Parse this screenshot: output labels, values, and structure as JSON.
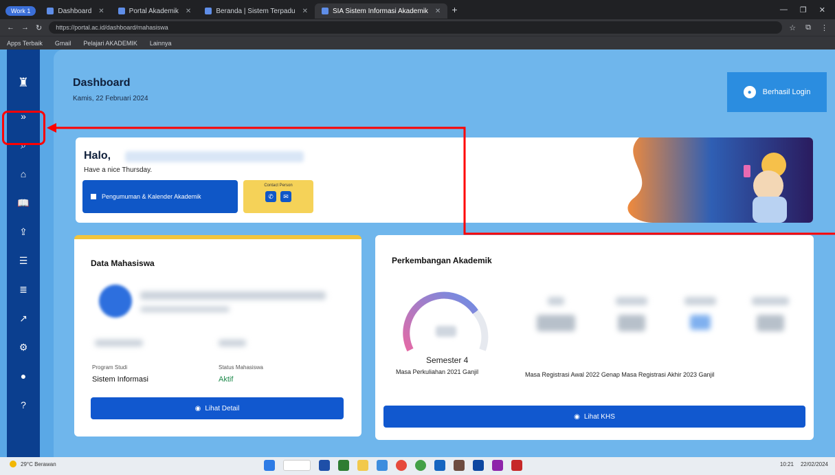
{
  "browser": {
    "profile_label": "Work 1",
    "tabs": [
      {
        "title": "Dashboard",
        "active": false
      },
      {
        "title": "Portal Akademik",
        "active": false
      },
      {
        "title": "Beranda | Sistem Terpadu",
        "active": false
      },
      {
        "title": "SIA Sistem Informasi Akademik",
        "active": true
      }
    ],
    "new_tab": "+",
    "window_controls": [
      "—",
      "❐",
      "✕"
    ],
    "nav": [
      "←",
      "→",
      "↻"
    ],
    "url": "https://portal.ac.id/dashboard/mahasiswa",
    "bookmarks": [
      "Apps Terbaik",
      "Gmail",
      "Pelajari AKADEMIK",
      "Lainnya"
    ]
  },
  "sidebar": {
    "logo_icon": "university-emblem-icon",
    "items": [
      {
        "name": "expand-sidebar",
        "glyph": "»"
      },
      {
        "name": "search",
        "glyph": "⌕"
      },
      {
        "name": "home",
        "glyph": "⌂"
      },
      {
        "name": "book",
        "glyph": "📖"
      },
      {
        "name": "upload",
        "glyph": "⇪"
      },
      {
        "name": "document",
        "glyph": "☰"
      },
      {
        "name": "list",
        "glyph": "≣"
      },
      {
        "name": "chart",
        "glyph": "↗"
      },
      {
        "name": "settings",
        "glyph": "⚙"
      },
      {
        "name": "profile",
        "glyph": "●"
      },
      {
        "name": "help",
        "glyph": "?"
      }
    ]
  },
  "header": {
    "title": "Dashboard",
    "date": "Kamis, 22 Februari 2024",
    "logout_label": "Berhasil Login"
  },
  "greeting": {
    "hello": "Halo,",
    "subtitle": "Have a nice Thursday.",
    "calendar_button": "Pengumuman & Kalender Akademik",
    "contact_label": "Contact Person"
  },
  "student_card": {
    "title": "Data Mahasiswa",
    "program_label": "Program Studi",
    "program_value": "Sistem Informasi",
    "status_label": "Status Mahasiswa",
    "status_value": "Aktif",
    "button_label": "Lihat Detail"
  },
  "academic_card": {
    "title": "Perkembangan Akademik",
    "semester": "Semester 4",
    "masa_start": "Masa Perkuliahan 2021 Ganjil",
    "masa_reg": "Masa Registrasi Awal 2022 Genap  Masa Registrasi Akhir 2023 Ganjil",
    "button_label": "Lihat KHS"
  },
  "taskbar": {
    "weather": "29°C Berawan",
    "time": "10:21",
    "date": "22/02/2024"
  }
}
